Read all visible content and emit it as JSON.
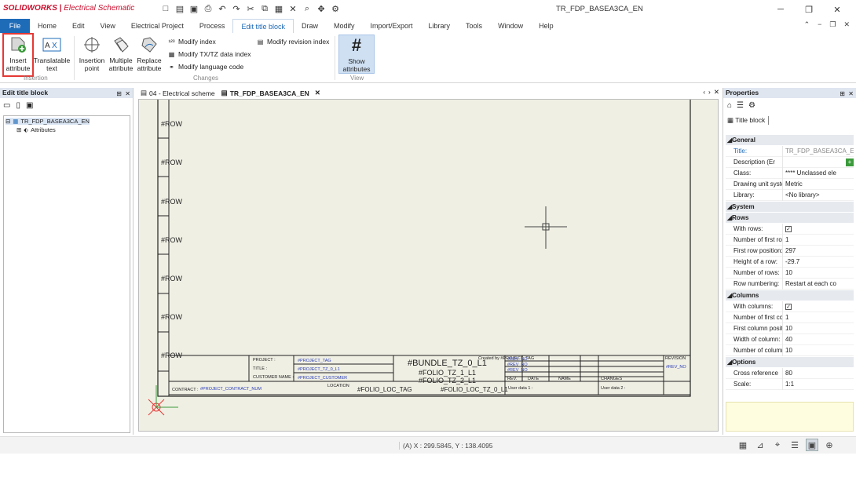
{
  "titlebar": {
    "brand": "SOLIDWORKS",
    "product": "Electrical Schematic",
    "document": "TR_FDP_BASEA3CA_EN"
  },
  "ribbon_tabs": [
    "File",
    "Home",
    "Edit",
    "View",
    "Electrical Project",
    "Process",
    "Edit title block",
    "Draw",
    "Modify",
    "Import/Export",
    "Library",
    "Tools",
    "Window",
    "Help"
  ],
  "ribbon": {
    "insert_attribute": "Insert attribute",
    "translatable_text": "Translatable text",
    "insertion_point": "Insertion point",
    "multiple_attribute": "Multiple attribute",
    "replace_attribute": "Replace attribute",
    "modify_index": "Modify index",
    "modify_txtz": "Modify TX/TZ data index",
    "modify_language": "Modify language code",
    "modify_revision": "Modify revision index",
    "show_attributes": "Show attributes",
    "groups": {
      "insertion": "Insertion",
      "changes": "Changes",
      "view": "View"
    }
  },
  "left_panel": {
    "title": "Edit title block",
    "tree_root": "TR_FDP_BASEA3CA_EN",
    "tree_child": "Attributes"
  },
  "doc_tabs": [
    "04 - Electrical scheme",
    "TR_FDP_BASEA3CA_EN"
  ],
  "drawing": {
    "row_label": "#ROW",
    "project_label": "PROJECT :",
    "project_val": "#PROJECT_TAG",
    "title_label": "TITLE :",
    "title_val": "#PROJECT_TZ_0_L1",
    "customer_label": "CUSTOMER NAME :",
    "customer_val": "#PROJECT_CUSTOMER",
    "contract_label": "CONTRACT :",
    "contract_val": "#PROJECT_CONTRACT_NUM",
    "location_label": "LOCATION",
    "folio_loc_tag": "#FOLIO_LOC_TAG",
    "folio_loc_tz": "#FOLIO_LOC_TZ_0_L1",
    "bundle": "#BUNDLE_TZ_0_L1",
    "folio1": "#FOLIO_TZ_1_L1",
    "folio2": "#FOLIO_TZ_2_L1",
    "rev_no": "#REV_NO",
    "rev": "REV.",
    "date": "DATE",
    "name": "NAME",
    "changes": "CHANGES",
    "revision": "REVISION",
    "rev_no2": "#REV_NO",
    "user1": "User data 1 :",
    "user2": "User data 2 :",
    "created_by": "Created by #PROJECT_TAG"
  },
  "properties": {
    "title": "Properties",
    "tab": "Title block",
    "sections": {
      "general": "General",
      "system": "System",
      "rows": "Rows",
      "columns": "Columns",
      "options": "Options"
    },
    "general": [
      [
        "Title:",
        "TR_FDP_BASEA3CA_E"
      ],
      [
        "Description (Er",
        ""
      ],
      [
        "Class:",
        "**** Unclassed ele"
      ],
      [
        "Drawing unit syste",
        "Metric"
      ],
      [
        "Library:",
        "<No library>"
      ]
    ],
    "rows": [
      [
        "With rows:",
        "✓"
      ],
      [
        "Number of first ro",
        "1"
      ],
      [
        "First row position:",
        "297"
      ],
      [
        "Height of a row:",
        "-29.7"
      ],
      [
        "Number of rows:",
        "10"
      ],
      [
        "Row numbering:",
        "Restart at each co"
      ]
    ],
    "columns": [
      [
        "With columns:",
        "✓"
      ],
      [
        "Number of first co",
        "1"
      ],
      [
        "First column positi",
        "10"
      ],
      [
        "Width of column:",
        "40"
      ],
      [
        "Number of columr",
        "10"
      ]
    ],
    "options": [
      [
        "Cross reference",
        "80"
      ],
      [
        "Scale:",
        "1:1"
      ]
    ]
  },
  "status": {
    "coords": "(A) X : 299.5845, Y : 138.4095"
  },
  "colors": {
    "accent": "#1e6bb8",
    "canvas": "#f0efe4",
    "highlight": "#e53935",
    "blue_text": "#2b3fb8"
  }
}
